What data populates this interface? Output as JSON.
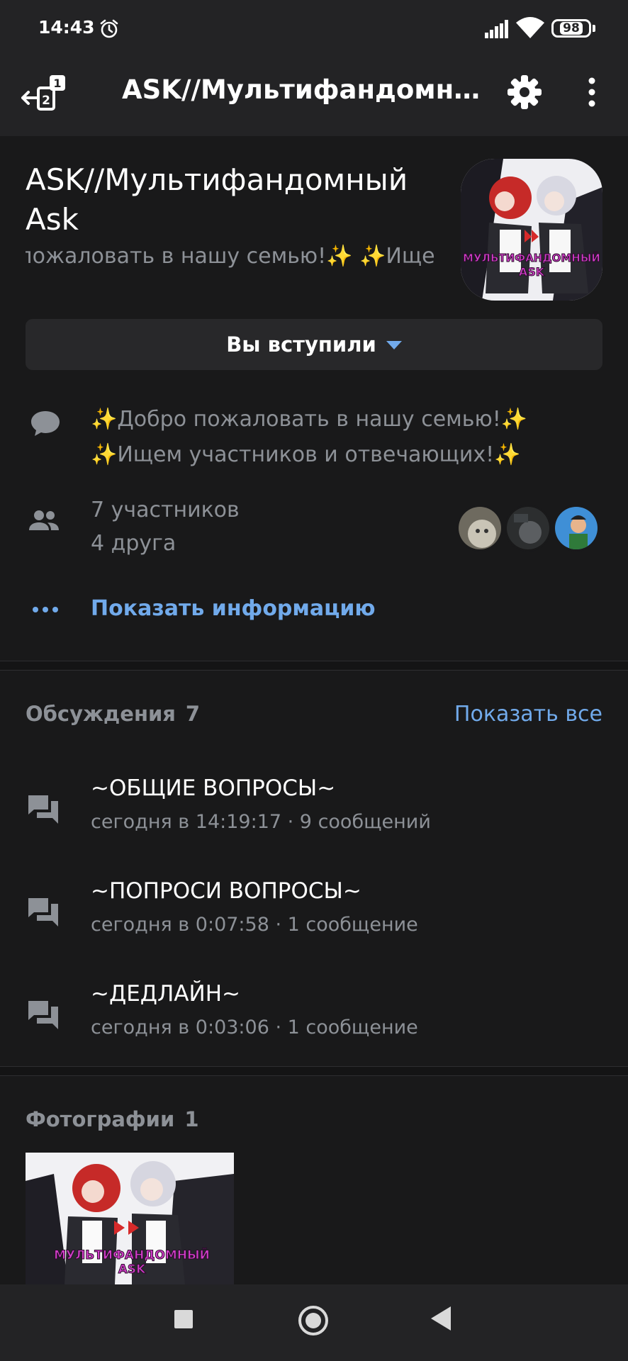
{
  "status_bar": {
    "time": "14:43",
    "battery": "98"
  },
  "header": {
    "title": "ASK//Мультифандомны...",
    "notification_badge": "1",
    "icons": [
      "exit-icon",
      "settings-icon",
      "more-icon"
    ]
  },
  "group": {
    "name": "ASK//Мультифандомный Ask",
    "status_line": "пожаловать в нашу семью!✨  ✨Ище",
    "avatar_caption": "МУЛЬТИФАНДОМНЫЙ ASK",
    "membership_label": "Вы вступили",
    "description_line1": "✨Добро пожаловать в нашу семью!✨",
    "description_line2": "✨Ищем участников и отвечающих!✨",
    "members_count": "7 участников",
    "friends_count": "4 друга",
    "show_info": "Показать информацию"
  },
  "discussions": {
    "heading": "Обсуждения",
    "count": "7",
    "show_all": "Показать все",
    "items": [
      {
        "title": "~ОБЩИЕ ВОПРОСЫ~",
        "meta": "сегодня в 14:19:17 · 9 сообщений"
      },
      {
        "title": "~ПОПРОСИ ВОПРОСЫ~",
        "meta": "сегодня в 0:07:58 · 1 сообщение"
      },
      {
        "title": "~ДЕДЛАЙН~",
        "meta": "сегодня в 0:03:06 · 1 сообщение"
      }
    ]
  },
  "photos": {
    "heading": "Фотографии",
    "count": "1",
    "thumb_caption": "МУЛЬТИФАНДОМНЫЙ ASK"
  },
  "colors": {
    "background": "#19191a",
    "header": "#232325",
    "accent": "#71aaeb",
    "secondary_text": "#8d9197"
  }
}
